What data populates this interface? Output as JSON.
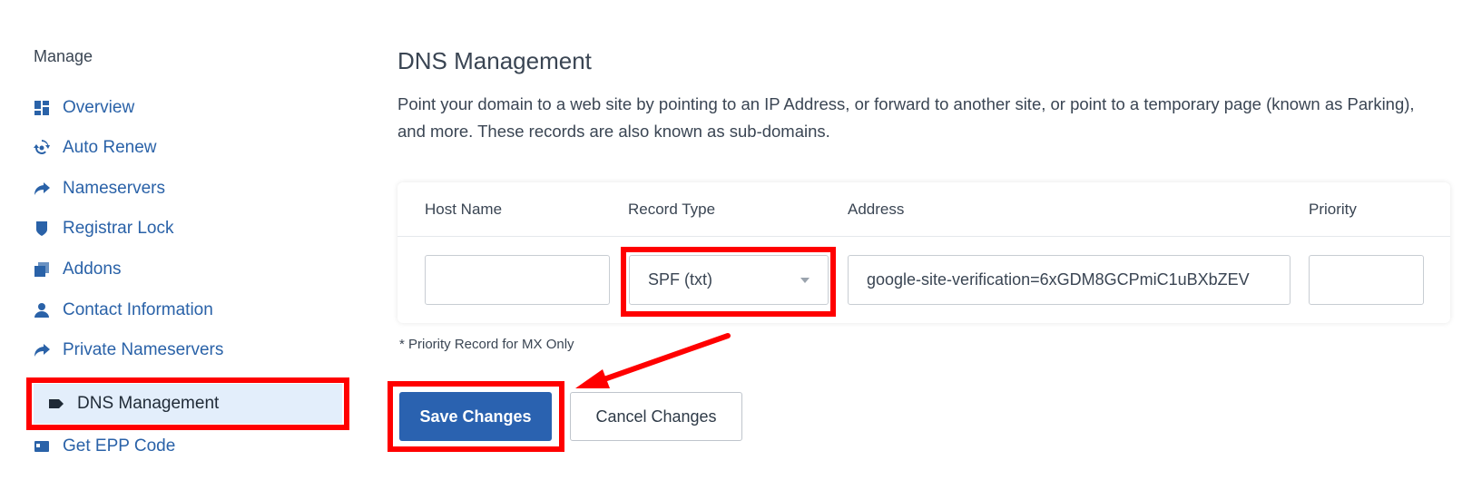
{
  "sidebar": {
    "heading": "Manage",
    "items": [
      {
        "label": "Overview",
        "icon": "dashboard-icon"
      },
      {
        "label": "Auto Renew",
        "icon": "sync-icon"
      },
      {
        "label": "Nameservers",
        "icon": "share-arrow-icon"
      },
      {
        "label": "Registrar Lock",
        "icon": "shield-icon"
      },
      {
        "label": "Addons",
        "icon": "addons-icon"
      },
      {
        "label": "Contact Information",
        "icon": "user-icon"
      },
      {
        "label": "Private Nameservers",
        "icon": "share-arrow-icon"
      },
      {
        "label": "DNS Management",
        "icon": "tag-icon",
        "active": true
      },
      {
        "label": "Get EPP Code",
        "icon": "id-card-icon"
      }
    ]
  },
  "main": {
    "title": "DNS Management",
    "description": "Point your domain to a web site by pointing to an IP Address, or forward to another site, or point to a temporary page (known as Parking), and more. These records are also known as sub-domains.",
    "table": {
      "headers": {
        "host": "Host Name",
        "record_type": "Record Type",
        "address": "Address",
        "priority": "Priority"
      },
      "row": {
        "host": "",
        "record_type": "SPF (txt)",
        "address": "google-site-verification=6xGDM8GCPmiC1uBXbZEV",
        "priority": ""
      }
    },
    "footnote": "* Priority Record for MX Only",
    "buttons": {
      "save": "Save Changes",
      "cancel": "Cancel Changes"
    }
  },
  "colors": {
    "link": "#2a62a8",
    "primary_button": "#2a62b0",
    "active_bg": "#e3eefb",
    "annotation": "#ff0000"
  }
}
